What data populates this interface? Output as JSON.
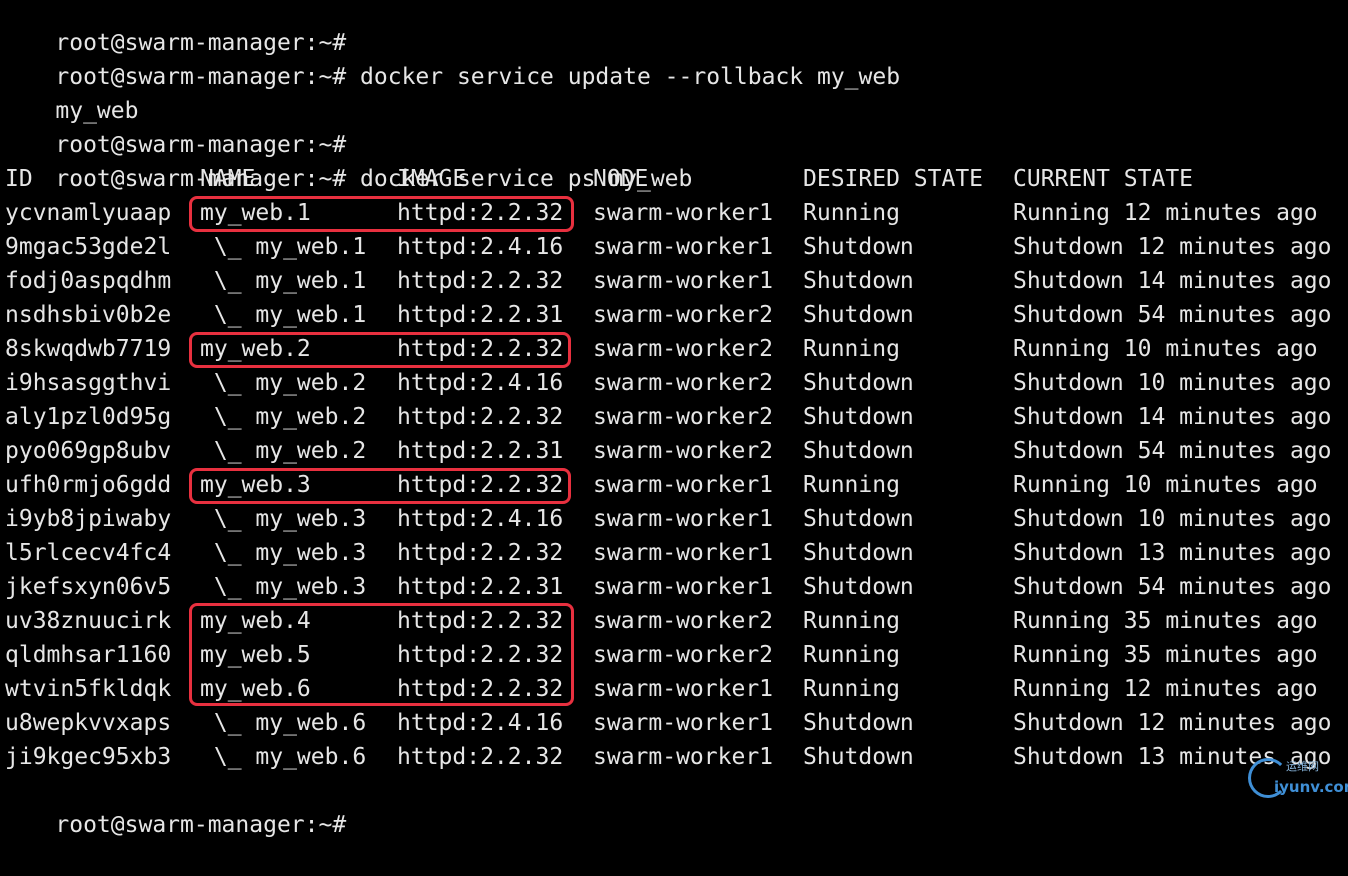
{
  "terminal": {
    "prompt": "root@swarm-manager:~#",
    "lines": [
      {
        "prompt": "root@swarm-manager:~#",
        "command": ""
      },
      {
        "prompt": "root@swarm-manager:~#",
        "command": " docker service update --rollback my_web"
      },
      {
        "output": "my_web"
      },
      {
        "prompt": "root@swarm-manager:~#",
        "command": ""
      },
      {
        "prompt": "root@swarm-manager:~#",
        "command": " docker service ps my_web"
      }
    ],
    "final_prompt": "root@swarm-manager:~#"
  },
  "table": {
    "headers": {
      "id": "ID",
      "name": "NAME",
      "image": "IMAGE",
      "node": "NODE",
      "desired": "DESIRED STATE",
      "current": "CURRENT STATE"
    },
    "rows": [
      {
        "id": "ycvnamlyuaap",
        "name": "my_web.1",
        "image": "httpd:2.2.32",
        "node": "swarm-worker1",
        "desired": "Running",
        "current": "Running 12 minutes ago"
      },
      {
        "id": "9mgac53gde2l",
        "name": " \\_ my_web.1",
        "image": "httpd:2.4.16",
        "node": "swarm-worker1",
        "desired": "Shutdown",
        "current": "Shutdown 12 minutes ago"
      },
      {
        "id": "fodj0aspqdhm",
        "name": " \\_ my_web.1",
        "image": "httpd:2.2.32",
        "node": "swarm-worker1",
        "desired": "Shutdown",
        "current": "Shutdown 14 minutes ago"
      },
      {
        "id": "nsdhsbiv0b2e",
        "name": " \\_ my_web.1",
        "image": "httpd:2.2.31",
        "node": "swarm-worker2",
        "desired": "Shutdown",
        "current": "Shutdown 54 minutes ago"
      },
      {
        "id": "8skwqdwb7719",
        "name": "my_web.2",
        "image": "httpd:2.2.32",
        "node": "swarm-worker2",
        "desired": "Running",
        "current": "Running 10 minutes ago"
      },
      {
        "id": "i9hsasggthvi",
        "name": " \\_ my_web.2",
        "image": "httpd:2.4.16",
        "node": "swarm-worker2",
        "desired": "Shutdown",
        "current": "Shutdown 10 minutes ago"
      },
      {
        "id": "aly1pzl0d95g",
        "name": " \\_ my_web.2",
        "image": "httpd:2.2.32",
        "node": "swarm-worker2",
        "desired": "Shutdown",
        "current": "Shutdown 14 minutes ago"
      },
      {
        "id": "pyo069gp8ubv",
        "name": " \\_ my_web.2",
        "image": "httpd:2.2.31",
        "node": "swarm-worker2",
        "desired": "Shutdown",
        "current": "Shutdown 54 minutes ago"
      },
      {
        "id": "ufh0rmjo6gdd",
        "name": "my_web.3",
        "image": "httpd:2.2.32",
        "node": "swarm-worker1",
        "desired": "Running",
        "current": "Running 10 minutes ago"
      },
      {
        "id": "i9yb8jpiwaby",
        "name": " \\_ my_web.3",
        "image": "httpd:2.4.16",
        "node": "swarm-worker1",
        "desired": "Shutdown",
        "current": "Shutdown 10 minutes ago"
      },
      {
        "id": "l5rlcecv4fc4",
        "name": " \\_ my_web.3",
        "image": "httpd:2.2.32",
        "node": "swarm-worker1",
        "desired": "Shutdown",
        "current": "Shutdown 13 minutes ago"
      },
      {
        "id": "jkefsxyn06v5",
        "name": " \\_ my_web.3",
        "image": "httpd:2.2.31",
        "node": "swarm-worker1",
        "desired": "Shutdown",
        "current": "Shutdown 54 minutes ago"
      },
      {
        "id": "uv38znuucirk",
        "name": "my_web.4",
        "image": "httpd:2.2.32",
        "node": "swarm-worker2",
        "desired": "Running",
        "current": "Running 35 minutes ago"
      },
      {
        "id": "qldmhsar1160",
        "name": "my_web.5",
        "image": "httpd:2.2.32",
        "node": "swarm-worker2",
        "desired": "Running",
        "current": "Running 35 minutes ago"
      },
      {
        "id": "wtvin5fkldqk",
        "name": "my_web.6",
        "image": "httpd:2.2.32",
        "node": "swarm-worker1",
        "desired": "Running",
        "current": "Running 12 minutes ago"
      },
      {
        "id": "u8wepkvvxaps",
        "name": " \\_ my_web.6",
        "image": "httpd:2.4.16",
        "node": "swarm-worker1",
        "desired": "Shutdown",
        "current": "Shutdown 12 minutes ago"
      },
      {
        "id": "ji9kgec95xb3",
        "name": " \\_ my_web.6",
        "image": "httpd:2.2.32",
        "node": "swarm-worker1",
        "desired": "Shutdown",
        "current": "Shutdown 13 minutes ago"
      }
    ]
  },
  "highlight_color": "#e8303f",
  "text_color": "#e6e6e6",
  "background_color": "#000000",
  "watermark": {
    "line1": "运维网",
    "line2": "iyunv.com",
    "icon": "logo-ring-icon"
  }
}
